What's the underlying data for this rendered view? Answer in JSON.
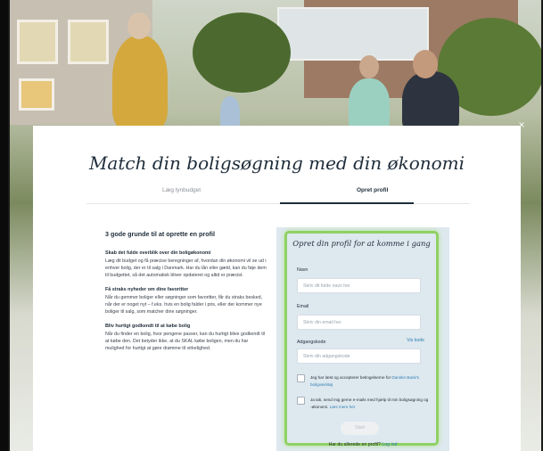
{
  "modal": {
    "title": "Match din boligsøgning med din økonomi",
    "close_label": "×",
    "tabs": [
      {
        "label": "Læg lynbudget",
        "active": false
      },
      {
        "label": "Opret profil",
        "active": true
      }
    ]
  },
  "reasons": {
    "heading": "3 gode grunde til at oprette en profil",
    "items": [
      {
        "title": "Skab det fulde overblik over din boligøkonomi",
        "text": "Læg dit budget og få præcise beregninger af, hvordan din økonomi vil se ud i enhver bolig, der er til salg i Danmark. Har du lån eller gæld, kan du føje dem til budgettet, så det automatisk bliver opdateret og altid er præcist."
      },
      {
        "title": "Få straks nyheder om dine favoritter",
        "text": "Når du gemmer boliger eller søgninger som favoritter, får du straks besked, når der er noget nyt – f.eks. hvis en bolig falder i pris, eller der kommer nye boliger til salg, som matcher dine søgninger."
      },
      {
        "title": "Bliv hurtigt godkendt til at købe bolig",
        "text": "Når du finder en bolig, hvor pengene passer, kan du hurtigt blive godkendt til at købe den. Det betyder ikke, at du SKAL købe boligen, men du har mulighed for hurtigt at gøre drømme til virkelighed."
      }
    ]
  },
  "form": {
    "title": "Opret din profil for at komme i gang",
    "name_label": "Navn",
    "name_placeholder": "Skriv dit fulde navn her",
    "email_label": "Email",
    "email_placeholder": "Skriv din email her",
    "password_label": "Adgangskode",
    "password_placeholder": "Skriv din adgangskode",
    "show_password": "Vis kode",
    "terms_text": "Jeg har læst og accepterer betingelserne for",
    "terms_link": "Danske Bank's boligværktøj",
    "marketing_text": "Ja tak, send mig gerne e-mails med hjælp til min boligsøgning og -økonomi.",
    "marketing_link": "Læs mere her",
    "start_button": "Start",
    "login_prompt": "Har du allerede en profil?",
    "login_link": "Log ind"
  },
  "colors": {
    "form_border": "#8fd163",
    "panel_bg": "#dde8ef",
    "link": "#2f7fb3",
    "title": "#1f2d3a"
  }
}
